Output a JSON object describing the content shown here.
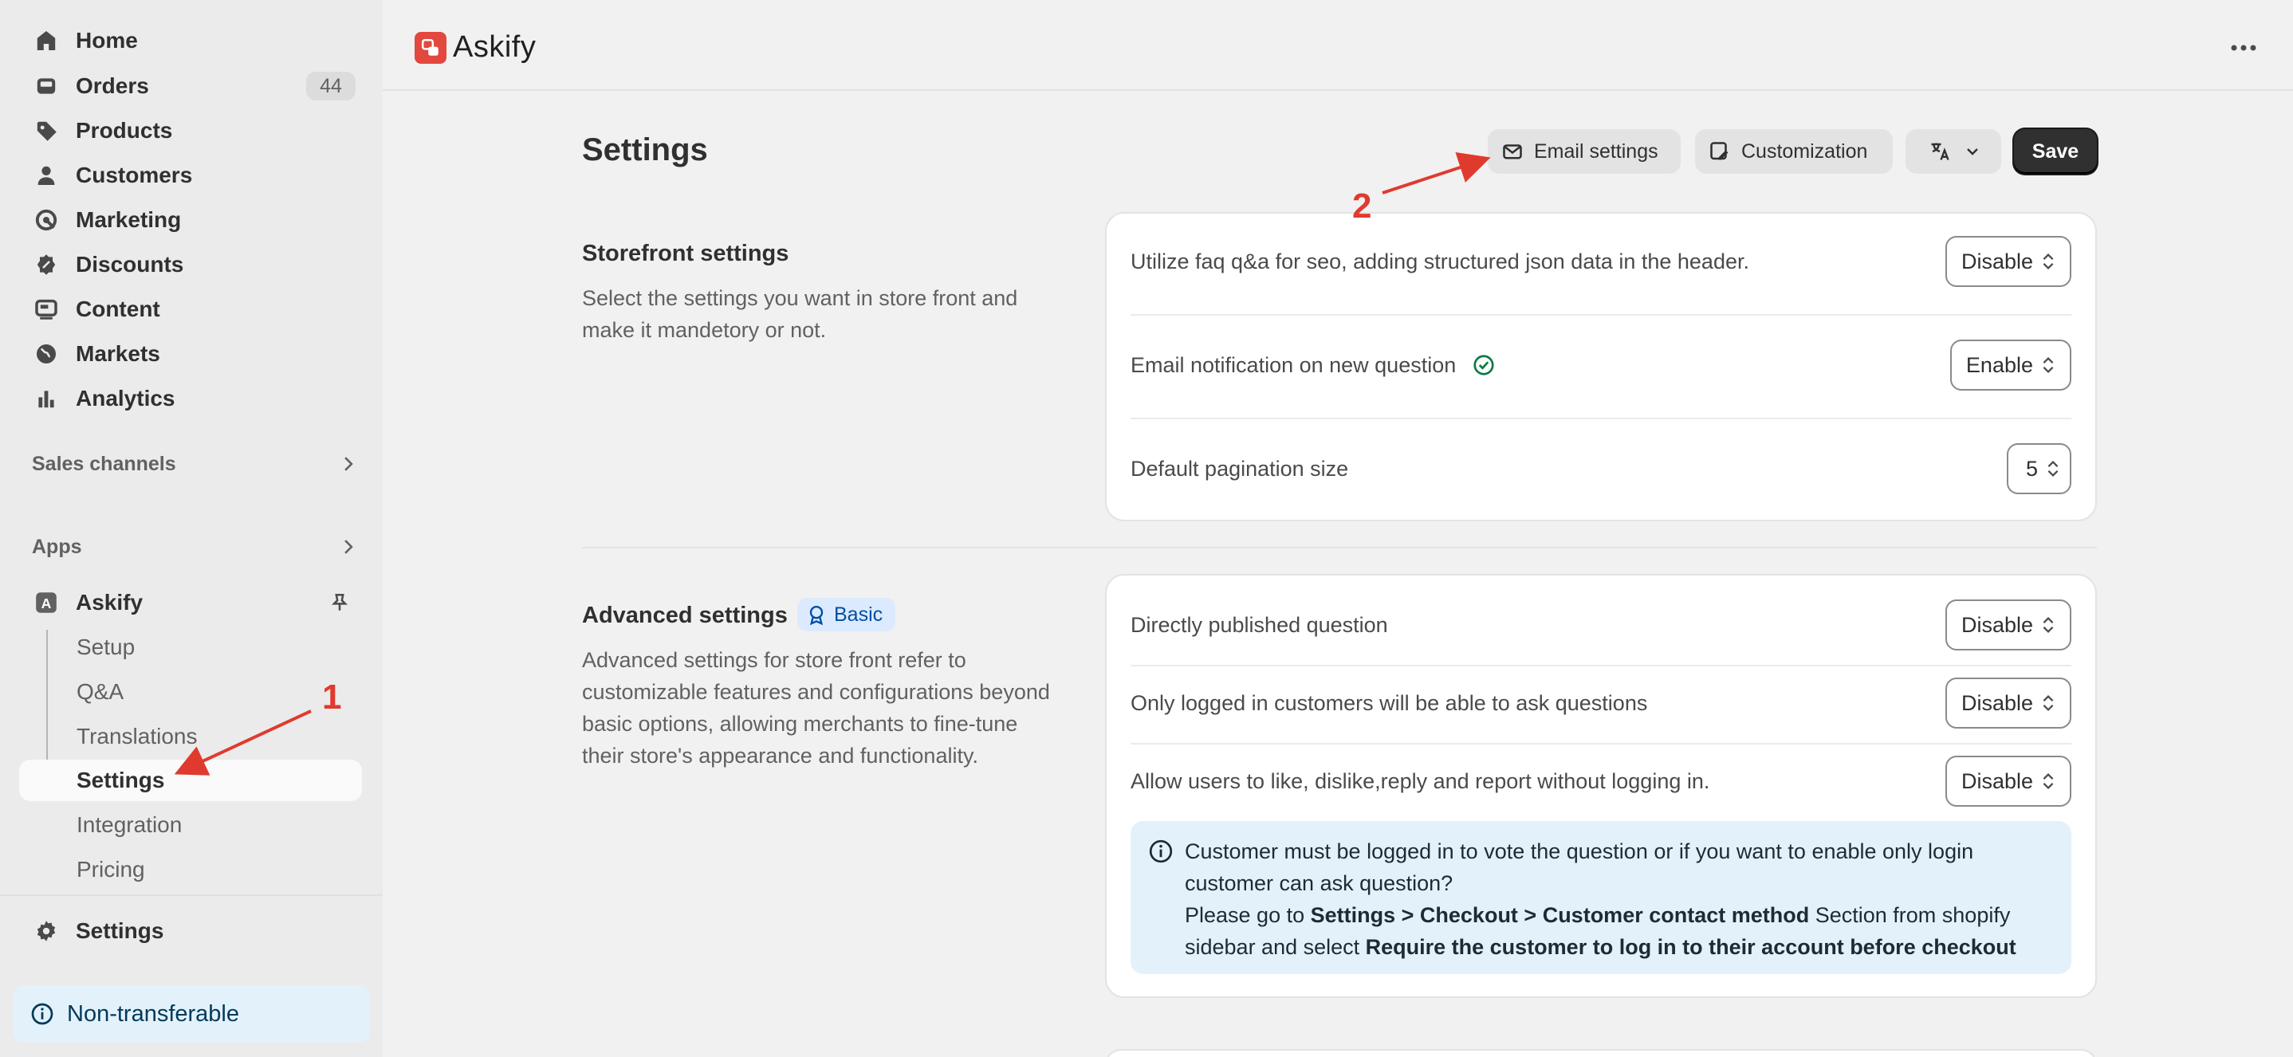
{
  "sidebar": {
    "nav": [
      {
        "label": "Home",
        "icon": "home-icon"
      },
      {
        "label": "Orders",
        "icon": "inbox-icon",
        "badge": "44"
      },
      {
        "label": "Products",
        "icon": "tag-icon"
      },
      {
        "label": "Customers",
        "icon": "person-icon"
      },
      {
        "label": "Marketing",
        "icon": "target-icon"
      },
      {
        "label": "Discounts",
        "icon": "discount-icon"
      },
      {
        "label": "Content",
        "icon": "content-icon"
      },
      {
        "label": "Markets",
        "icon": "globe-icon"
      },
      {
        "label": "Analytics",
        "icon": "bar-chart-icon"
      }
    ],
    "sales_channels": "Sales channels",
    "apps": "Apps",
    "app_name": "Askify",
    "app_sub_items": [
      "Setup",
      "Q&A",
      "Translations",
      "Settings",
      "Integration",
      "Pricing"
    ],
    "settings": "Settings",
    "non_transferable": "Non-transferable"
  },
  "topbar": {
    "title": "Askify"
  },
  "header": {
    "title": "Settings",
    "email_settings": "Email settings",
    "customization": "Customization",
    "save": "Save"
  },
  "storefront": {
    "title": "Storefront settings",
    "description": "Select the settings you want in store front and make it mandetory or not.",
    "rows": [
      {
        "label": "Utilize faq q&a for seo, adding structured json data in the header.",
        "value": "Disable"
      },
      {
        "label": "Email notification on new question",
        "value": "Enable"
      },
      {
        "label": "Default pagination size",
        "value": "5"
      }
    ]
  },
  "advanced": {
    "title": "Advanced settings",
    "badge": "Basic",
    "description": "Advanced settings for store front refer to customizable features and configurations beyond basic options, allowing merchants to fine-tune their store's appearance and functionality.",
    "rows": [
      {
        "label": "Directly published question",
        "value": "Disable"
      },
      {
        "label": "Only logged in customers will be able to ask questions",
        "value": "Disable"
      },
      {
        "label": "Allow users to like, dislike,reply and report without logging in.",
        "value": "Disable"
      }
    ],
    "info": {
      "line1": "Customer must be logged in to vote the question or if you want to enable only login customer can ask question?",
      "line2_pre": "Please go to ",
      "line2_bold": "Settings > Checkout > Customer contact method",
      "line2_mid": " Section from shopify sidebar and select ",
      "line2_bold2": "Require the customer to log in to their account before checkout"
    }
  },
  "annotations": {
    "one": "1",
    "two": "2"
  },
  "colors": {
    "accent_red": "#e03a2f",
    "save_bg": "#303030",
    "info_bg": "#e3f1fb",
    "badge_bg": "#dbeafe"
  }
}
